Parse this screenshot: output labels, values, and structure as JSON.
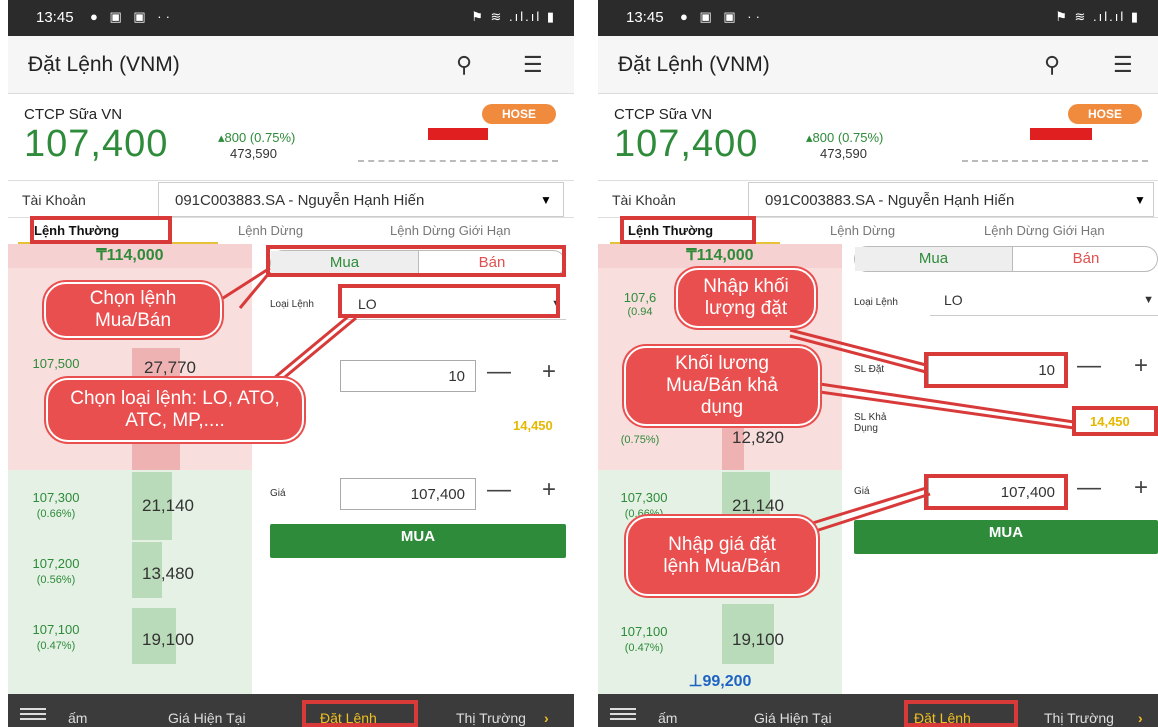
{
  "status": {
    "time": "13:45"
  },
  "header": {
    "title": "Đặt Lệnh (VNM)"
  },
  "stock": {
    "name": "CTCP Sữa VN",
    "exchange": "HOSE",
    "price": "107,400",
    "change": "800 (0.75%)",
    "volume": "473,590"
  },
  "account": {
    "label": "Tài Khoản",
    "value": "091C003883.SA - Nguyễn Hạnh Hiến"
  },
  "tabs": [
    "Lệnh Thường",
    "Lệnh Dừng",
    "Lệnh Dừng Giới Hạn"
  ],
  "orderbook": {
    "ceiling": "114,000",
    "floor": "99,200",
    "left": {
      "sell": [
        {
          "price": "107,500",
          "qty": "27,770"
        }
      ],
      "buy": [
        {
          "price": "107,300",
          "pct": "(0.66%)",
          "qty": "21,140"
        },
        {
          "price": "107,200",
          "pct": "(0.56%)",
          "qty": "13,480"
        },
        {
          "price": "107,100",
          "pct": "(0.47%)",
          "qty": "19,100"
        }
      ]
    },
    "right": {
      "sell": [
        {
          "price": "107,6",
          "pct": "(0.94",
          "qty": ""
        },
        {
          "price": "",
          "pct": "(0.75%)",
          "qty": "12,820"
        }
      ],
      "buy": [
        {
          "price": "107,300",
          "pct": "(0.66%)",
          "qty": "21,140"
        },
        {
          "price": "107,100",
          "pct": "(0.47%)",
          "qty": "19,100"
        }
      ]
    }
  },
  "form": {
    "buy_label": "Mua",
    "sell_label": "Bán",
    "order_type_label": "Loại Lệnh",
    "order_type_value": "LO",
    "qty_label": "SL Đặt",
    "qty_value": "10",
    "available_label": "SL Khả Dụng",
    "available_value": "14,450",
    "price_label": "Giá",
    "price_value": "107,400",
    "submit_label": "MUA",
    "minus": "—",
    "plus": "+"
  },
  "bottom_nav": [
    "ấm",
    "Giá Hiện Tại",
    "Đặt Lệnh",
    "Thị Trường"
  ],
  "callouts_left": {
    "buy_sell": "Chọn lệnh Mua/Bán",
    "order_type": "Chọn loại lệnh: LO, ATO, ATC, MP,...."
  },
  "callouts_right": {
    "qty": "Nhập khối lượng đặt",
    "available": "Khối lương Mua/Bán khả dụng",
    "price": "Nhập giá đặt lệnh Mua/Bán"
  },
  "colors": {
    "green": "#2e8b3a",
    "red": "#e02020",
    "highlight": "#d83a3a",
    "accent": "#f0c020"
  }
}
